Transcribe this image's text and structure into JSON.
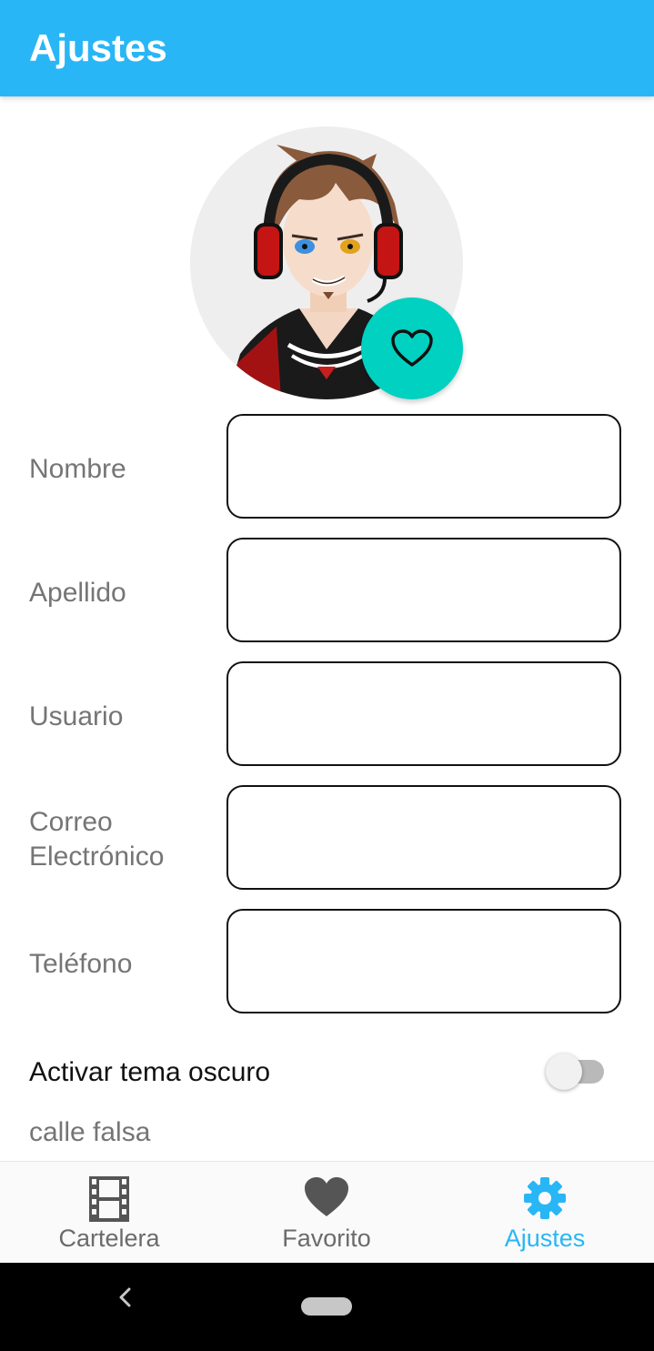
{
  "appbar": {
    "title": "Ajustes",
    "color": "#29b6f6"
  },
  "profile": {
    "avatar_icon": "avatar-image",
    "fab_icon": "heart-outline-icon",
    "fab_color": "#00d1c1"
  },
  "form": {
    "fields": [
      {
        "label": "Nombre",
        "value": ""
      },
      {
        "label": "Apellido",
        "value": ""
      },
      {
        "label": "Usuario",
        "value": ""
      },
      {
        "label": "Correo\nElectrónico",
        "value": ""
      },
      {
        "label": "Teléfono",
        "value": ""
      }
    ]
  },
  "theme": {
    "label": "Activar tema oscuro",
    "enabled": false
  },
  "address": "calle falsa",
  "bottom_nav": {
    "items": [
      {
        "label": "Cartelera",
        "icon": "film-icon",
        "active": false
      },
      {
        "label": "Favorito",
        "icon": "heart-icon",
        "active": false
      },
      {
        "label": "Ajustes",
        "icon": "gear-icon",
        "active": true
      }
    ],
    "active_color": "#29b6f6"
  },
  "system_nav": {
    "back_icon": "back-icon",
    "home_icon": "home-pill-icon"
  }
}
